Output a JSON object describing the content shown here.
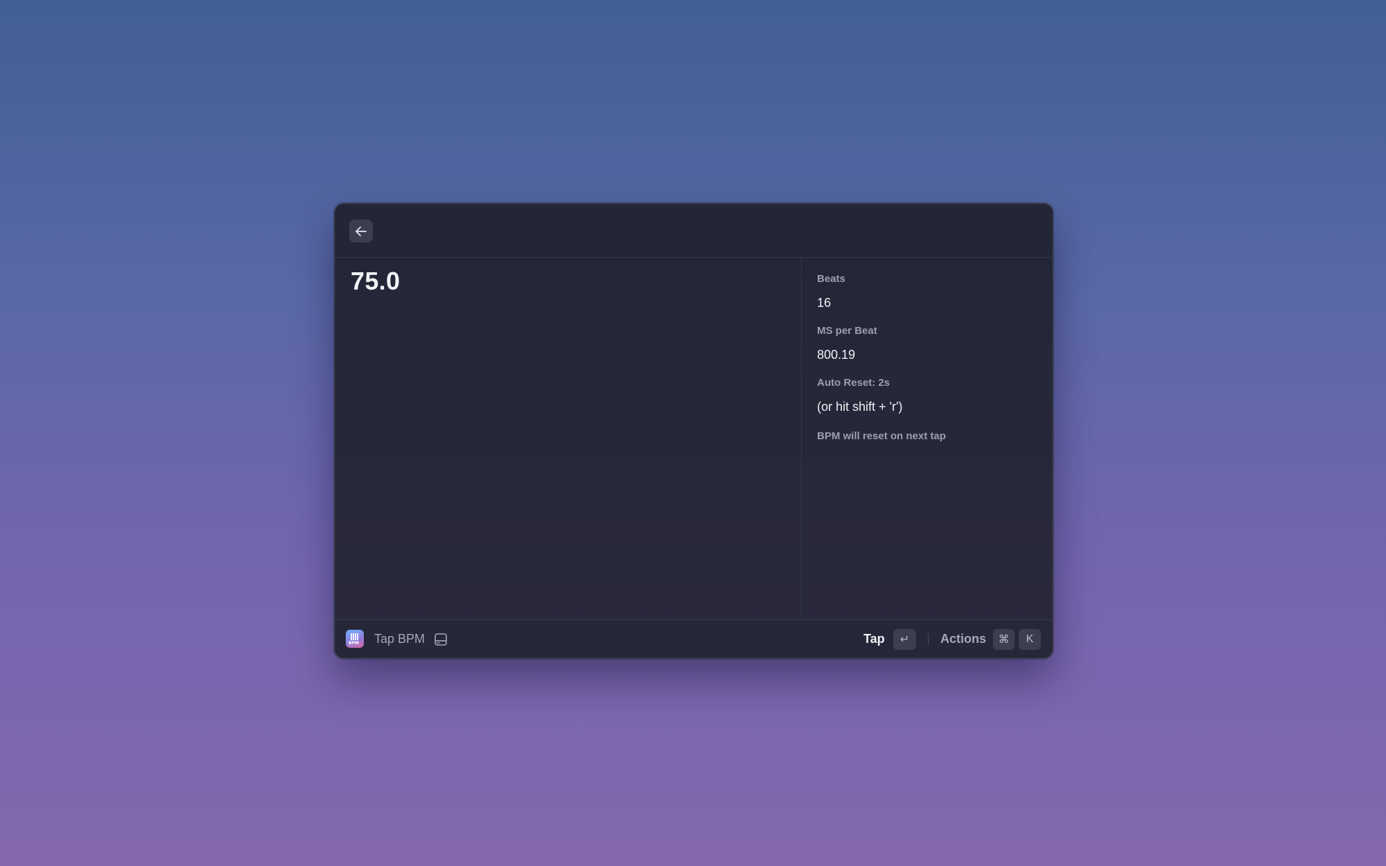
{
  "window": {
    "back_icon": "arrow-left-icon"
  },
  "main": {
    "bpm_value": "75.0"
  },
  "details": {
    "beats_label": "Beats",
    "beats_value": "16",
    "ms_label": "MS per Beat",
    "ms_value": "800.19",
    "reset_label": "Auto Reset: 2s",
    "reset_value": "(or hit shift + 'r')",
    "reset_note": "BPM will reset on next tap"
  },
  "footer": {
    "app_icon": "tap-bpm-app-icon",
    "app_icon_text": "BPM",
    "app_name": "Tap BPM",
    "panel_icon": "panel-toggle-icon",
    "primary_action": "Tap",
    "enter_key": "↵",
    "actions_label": "Actions",
    "cmd_key": "⌘",
    "k_key": "K"
  }
}
